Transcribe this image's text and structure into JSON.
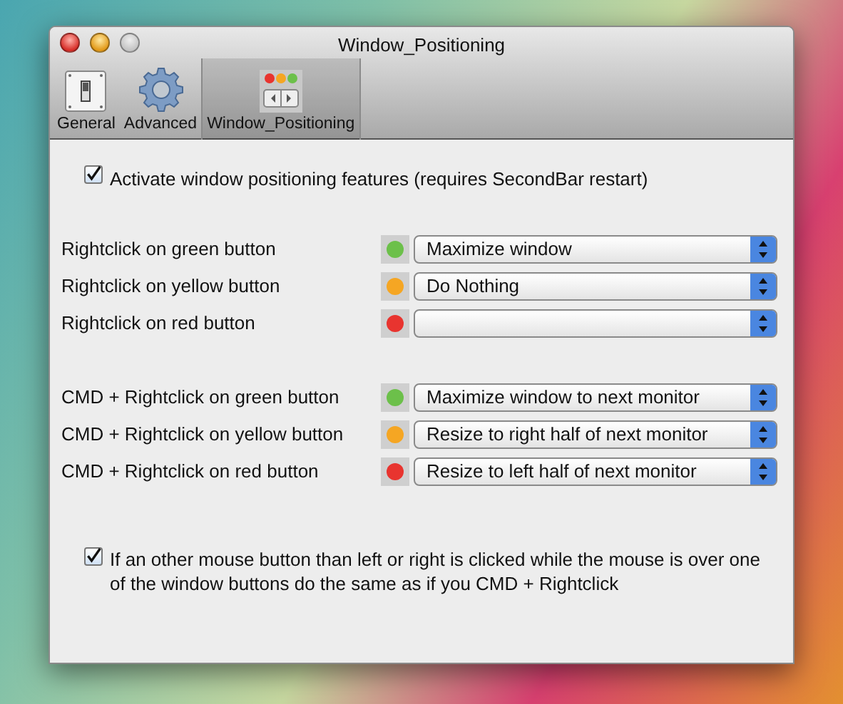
{
  "window": {
    "title": "Window_Positioning",
    "buttons": [
      {
        "kind": "close",
        "disabled": false
      },
      {
        "kind": "minimize",
        "disabled": false
      },
      {
        "kind": "zoom",
        "disabled": true
      }
    ]
  },
  "toolbar": {
    "items": [
      {
        "label": "General",
        "kind": "switch",
        "selected": false
      },
      {
        "label": "Advanced",
        "kind": "gear",
        "selected": false
      },
      {
        "label": "Window_Positioning",
        "kind": "windows",
        "selected": true
      }
    ]
  },
  "activate": {
    "label": "Activate window positioning features (requires SecondBar restart)",
    "checked": true
  },
  "groups": [
    [
      {
        "label": "Rightclick on green button",
        "color": "#6cc04a",
        "value": "Maximize window"
      },
      {
        "label": "Rightclick on yellow button",
        "color": "#f5a623",
        "value": "Do Nothing"
      },
      {
        "label": "Rightclick on red button",
        "color": "#e8342f"
      }
    ],
    [
      {
        "label": "CMD + Rightclick on green button",
        "color": "#6cc04a",
        "value": "Maximize window to next monitor"
      },
      {
        "label": "CMD + Rightclick on yellow button",
        "color": "#f5a623",
        "value": "Resize to right half of next monitor"
      },
      {
        "label": "CMD + Rightclick on red button",
        "color": "#e8342f",
        "value": "Resize to left half of next monitor"
      }
    ]
  ],
  "other_button": {
    "label": "If an other mouse button than left or right is clicked while the mouse is over one of the window buttons do the same as if you CMD + Rightclick",
    "checked": true
  }
}
